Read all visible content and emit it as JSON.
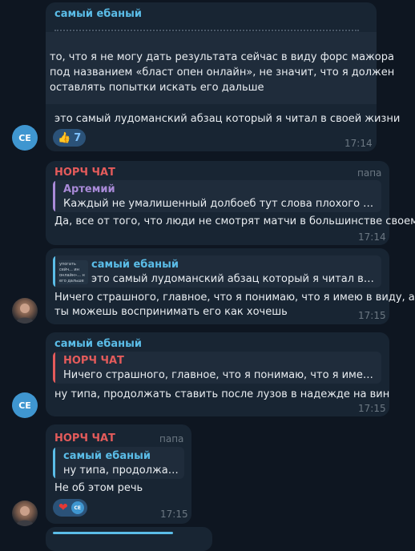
{
  "messages": [
    {
      "sender": "самый ебаный",
      "lines": [
        "то, что я не могу дать результата сейчас в виду форс мажора",
        "под названием «бласт опен онлайн», не значит, что я должен",
        "оставлять попытки искать его дальше"
      ],
      "text": "это самый лудоманский абзац который я читал в своей жизни",
      "reaction": {
        "emoji": "👍",
        "count": "7"
      },
      "time": "17:14",
      "avatar": "CE"
    },
    {
      "sender": "НОРЧ ЧАТ",
      "tag": "папа",
      "quote": {
        "name": "Артемий",
        "text": "Каждый не умалишенный долбоеб тут слова плохого не нап..."
      },
      "text": "Да, все от того, что люди не смотрят матчи в большинстве своем",
      "time": "17:14"
    },
    {
      "quote": {
        "name": "самый ебаный",
        "text": "это самый лудоманский абзац который я читал в своей...",
        "thumb": "упогать сейч... ин онлайн»... н его дальше"
      },
      "lines": [
        "Ничего страшного, главное, что я понимаю, что я имею в виду, а",
        "ты можешь воспринимать его как хочешь"
      ],
      "time": "17:15"
    },
    {
      "sender": "самый ебаный",
      "quote": {
        "name": "НОРЧ ЧАТ",
        "text": "Ничего страшного, главное, что я понимаю, что я имею в ви..."
      },
      "text": "ну типа, продолжать ставить после лузов в надежде на вин",
      "time": "17:15",
      "avatar": "CE"
    },
    {
      "sender": "НОРЧ ЧАТ",
      "tag": "папа",
      "quote": {
        "name": "самый ебаный",
        "text": "ну типа, продолжать ..."
      },
      "text": "Не об этом речь",
      "reaction": {
        "emoji": "❤",
        "avatar": "CE"
      },
      "time": "17:15"
    }
  ],
  "colors": {
    "background": "#0e1621",
    "bubble": "#182533",
    "name_blue": "#5bbde8",
    "name_red": "#e45b5b",
    "name_purple": "#a98ad8",
    "avatar_blue": "#3f96d0",
    "reaction_bg": "#2b5278"
  }
}
